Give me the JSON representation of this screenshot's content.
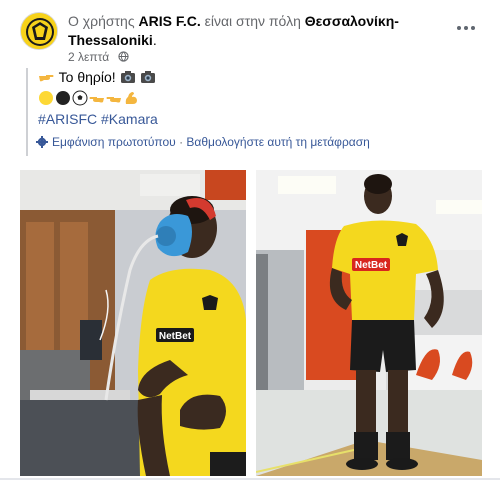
{
  "post": {
    "prefix": "Ο χρήστης ",
    "author": "ARIS F.C.",
    "middle": " είναι στην πόλη ",
    "place": "Θεσσαλονίκη-Thessaloniki",
    "suffix": ".",
    "timestamp": "2 λεπτά",
    "more_icon": "more-horizontal-icon",
    "line1_text": " Το θηρίο! ",
    "hashtag1": "#ARISFC",
    "hashtag2": "#Kamara",
    "translation_show": "Εμφάνιση πρωτοτύπου",
    "translation_sep": " · ",
    "translation_rate": "Βαθμολογήστε αυτή τη μετάφραση"
  },
  "photos": {
    "left_shirt_sponsor": "NetBet",
    "right_shirt_sponsor": "NetBet"
  },
  "colors": {
    "link": "#385898",
    "muted": "#65676b",
    "aris_yellow": "#f5d30f"
  }
}
